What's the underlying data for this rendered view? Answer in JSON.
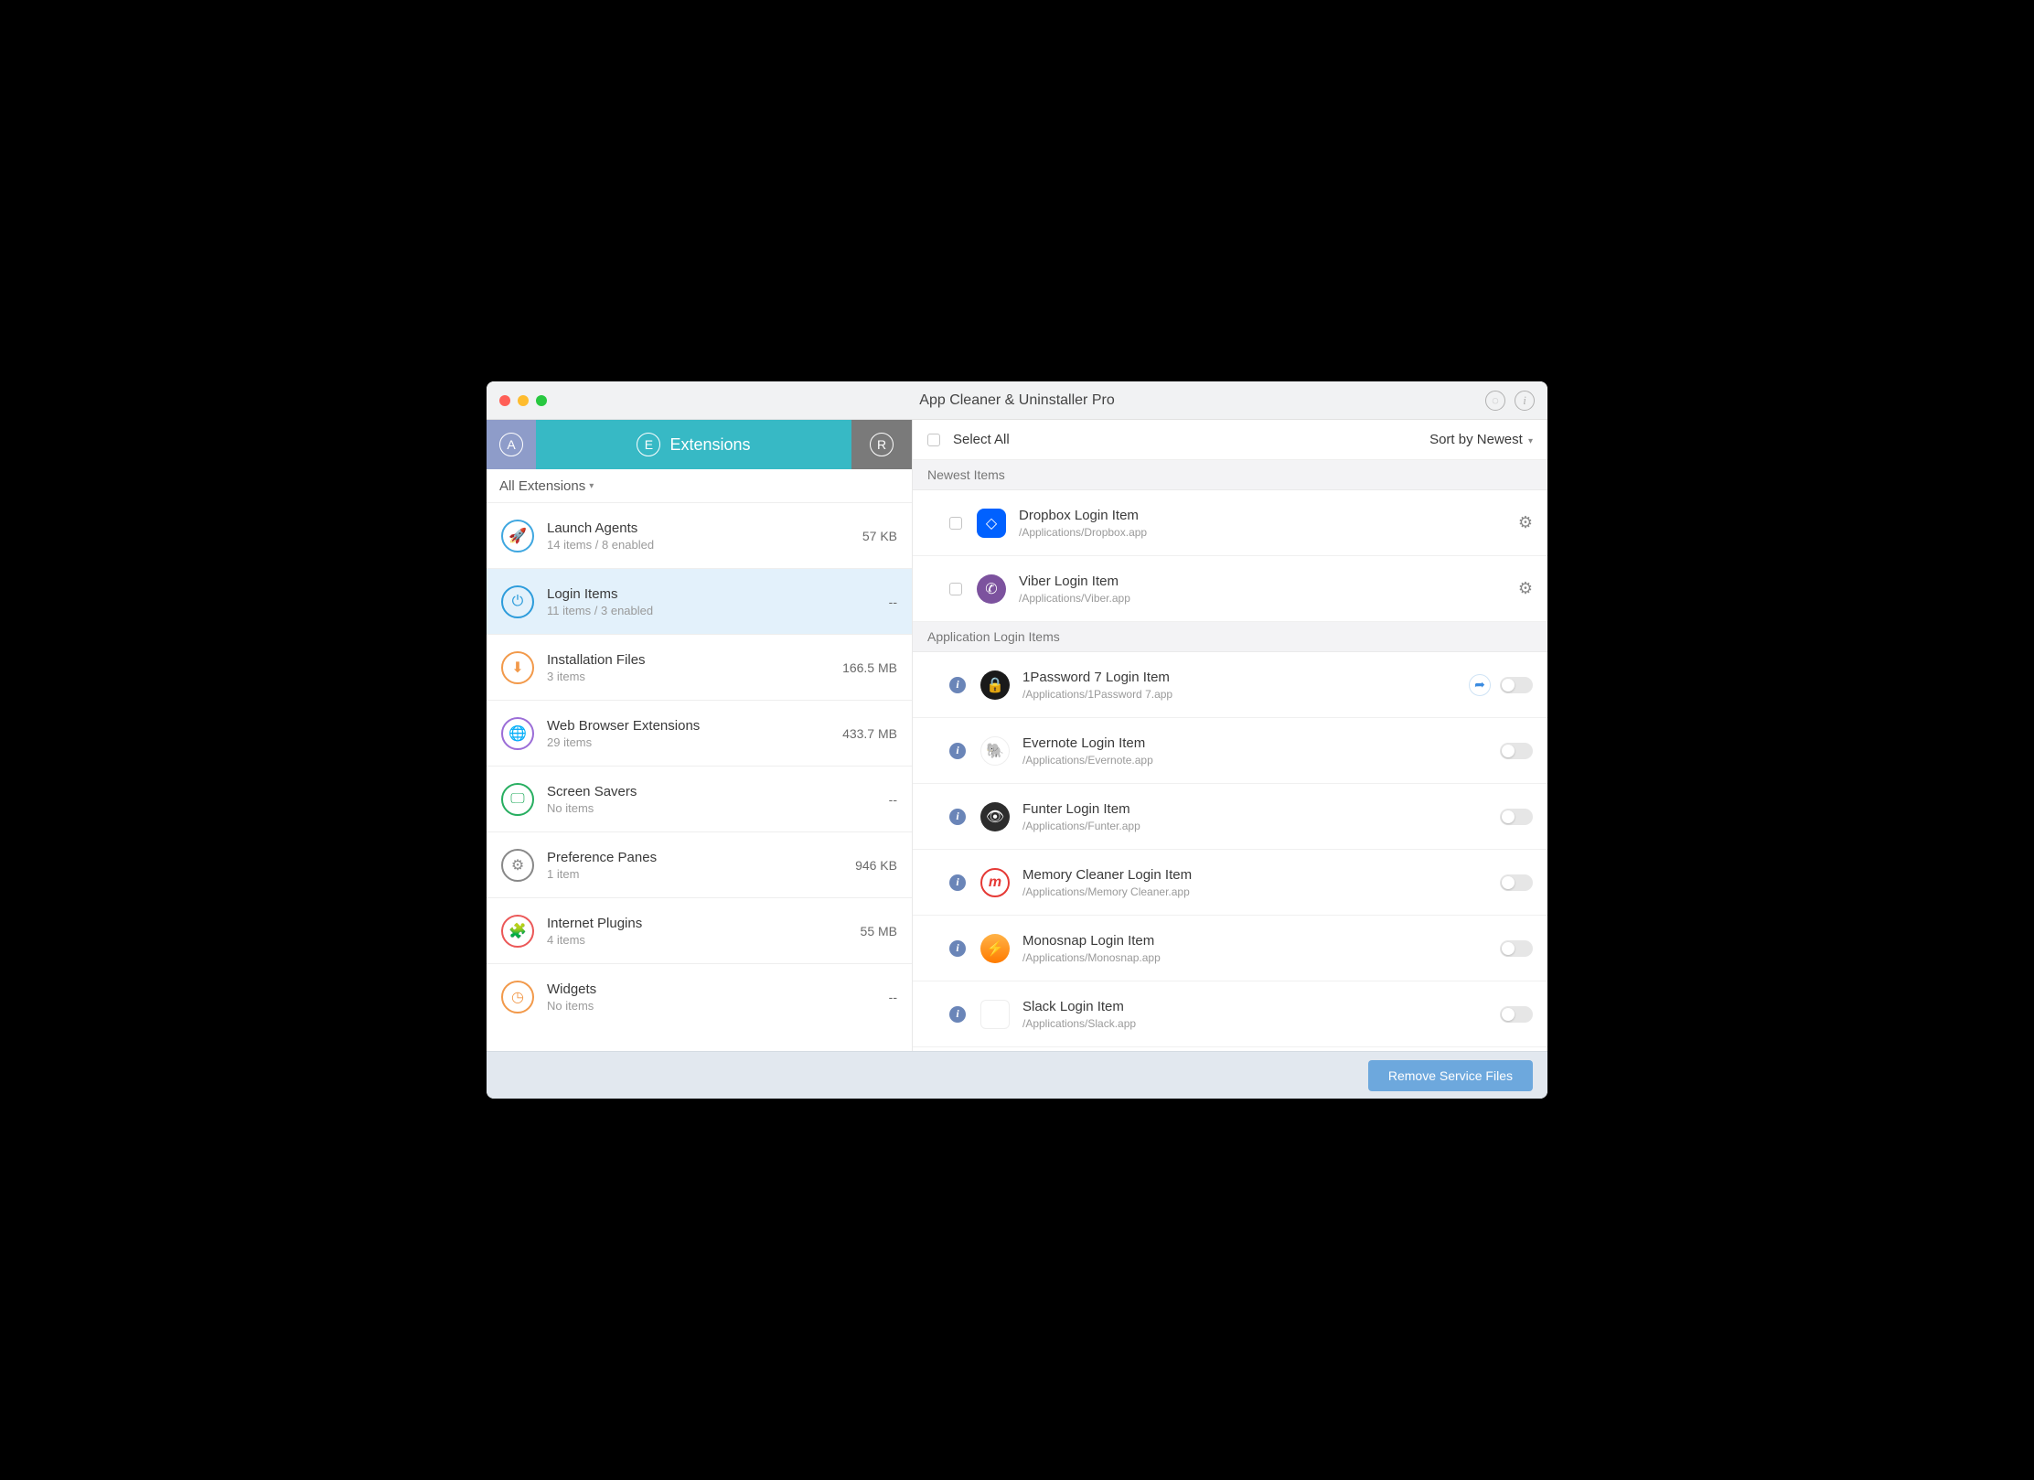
{
  "window": {
    "title": "App Cleaner & Uninstaller Pro"
  },
  "maintabs": {
    "extensions_label": "Extensions"
  },
  "filter": {
    "label": "All Extensions"
  },
  "categories": [
    {
      "title": "Launch Agents",
      "sub": "14 items / 8 enabled",
      "size": "57 KB",
      "iconClass": "ci-blue",
      "glyph": "🚀",
      "selected": false
    },
    {
      "title": "Login Items",
      "sub": "11 items / 3 enabled",
      "size": "--",
      "iconClass": "ci-blue2",
      "glyph": "⏻",
      "selected": true
    },
    {
      "title": "Installation Files",
      "sub": "3 items",
      "size": "166.5 MB",
      "iconClass": "ci-orange",
      "glyph": "⬇",
      "selected": false
    },
    {
      "title": "Web Browser Extensions",
      "sub": "29 items",
      "size": "433.7 MB",
      "iconClass": "ci-purple",
      "glyph": "🌐",
      "selected": false
    },
    {
      "title": "Screen Savers",
      "sub": "No items",
      "size": "--",
      "iconClass": "ci-green",
      "glyph": "🖵",
      "selected": false
    },
    {
      "title": "Preference Panes",
      "sub": "1 item",
      "size": "946 KB",
      "iconClass": "ci-gray",
      "glyph": "⚙",
      "selected": false
    },
    {
      "title": "Internet Plugins",
      "sub": "4 items",
      "size": "55 MB",
      "iconClass": "ci-red",
      "glyph": "🧩",
      "selected": false
    },
    {
      "title": "Widgets",
      "sub": "No items",
      "size": "--",
      "iconClass": "ci-orange2",
      "glyph": "◷",
      "selected": false
    }
  ],
  "toolbar": {
    "select_all": "Select All",
    "sort": "Sort by Newest"
  },
  "sections": {
    "newest": "Newest Items",
    "app_login": "Application Login Items"
  },
  "newest_items": [
    {
      "title": "Dropbox Login Item",
      "path": "/Applications/Dropbox.app",
      "iconClass": "ai-dropbox",
      "glyph": "◇"
    },
    {
      "title": "Viber Login Item",
      "path": "/Applications/Viber.app",
      "iconClass": "ai-viber",
      "glyph": "✆"
    }
  ],
  "app_items": [
    {
      "title": "1Password 7 Login Item",
      "path": "/Applications/1Password 7.app",
      "iconClass": "ai-1pw",
      "glyph": "🔒",
      "share": true
    },
    {
      "title": "Evernote Login Item",
      "path": "/Applications/Evernote.app",
      "iconClass": "ai-evernote",
      "glyph": "🐘",
      "share": false
    },
    {
      "title": "Funter Login Item",
      "path": "/Applications/Funter.app",
      "iconClass": "ai-funter",
      "glyph": "👁",
      "share": false
    },
    {
      "title": "Memory Cleaner Login Item",
      "path": "/Applications/Memory Cleaner.app",
      "iconClass": "ai-memory",
      "glyph": "m",
      "share": false
    },
    {
      "title": "Monosnap Login Item",
      "path": "/Applications/Monosnap.app",
      "iconClass": "ai-monosnap",
      "glyph": "⚡",
      "share": false
    },
    {
      "title": "Slack Login Item",
      "path": "/Applications/Slack.app",
      "iconClass": "ai-slack",
      "glyph": "#",
      "share": false
    }
  ],
  "footer": {
    "remove_label": "Remove Service Files"
  }
}
